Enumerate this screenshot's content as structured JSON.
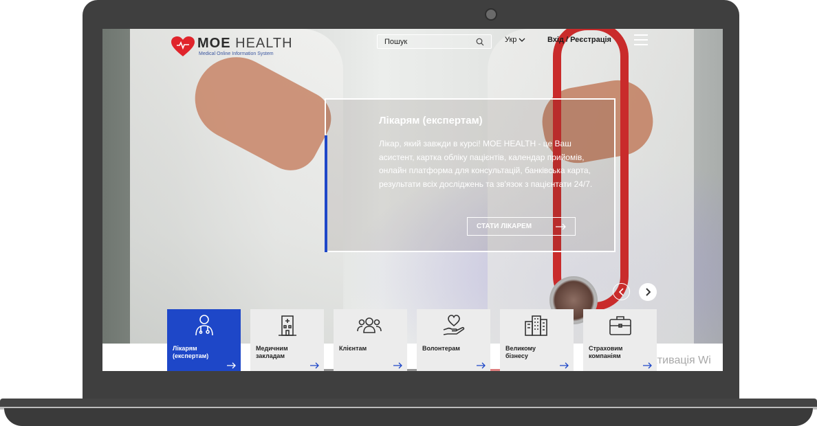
{
  "brand": {
    "name_bold": "МОЕ",
    "name_light": "HEALTH",
    "tagline": "Medical Online Information System"
  },
  "header": {
    "search_placeholder": "Пошук",
    "language": "Укр",
    "login_label": "Вхід / Реєстрація"
  },
  "hero": {
    "title": "Лікарям (експертам)",
    "text": "Лікар, який завжди в курсі! МОЕ HEALTH - це Ваш асистент, картка обліку пацієнтів, календар прийомів, онлайн платформа для консультацій, банківська карта, результати всіх досліджень та зв'язок з пацієнтати 24/7.",
    "cta_label": "СТАТИ ЛІКАРЕМ"
  },
  "categories": [
    {
      "label": "Лікарям (експертам)",
      "icon": "doctor-icon",
      "active": true
    },
    {
      "label": "Медичним закладам",
      "icon": "hospital-icon",
      "active": false
    },
    {
      "label": "Клієнтам",
      "icon": "people-icon",
      "active": false
    },
    {
      "label": "Волонтерам",
      "icon": "heart-hand-icon",
      "active": false
    },
    {
      "label": "Великому бізнесу",
      "icon": "buildings-icon",
      "active": false
    },
    {
      "label": "Страховим компаніям",
      "icon": "briefcase-icon",
      "active": false
    }
  ],
  "watermark": "Активація Wi",
  "colors": {
    "accent": "#1e47c8",
    "laptop": "#3f3f3f",
    "brand_red": "#e0242b",
    "tile_bg": "#ececec"
  }
}
